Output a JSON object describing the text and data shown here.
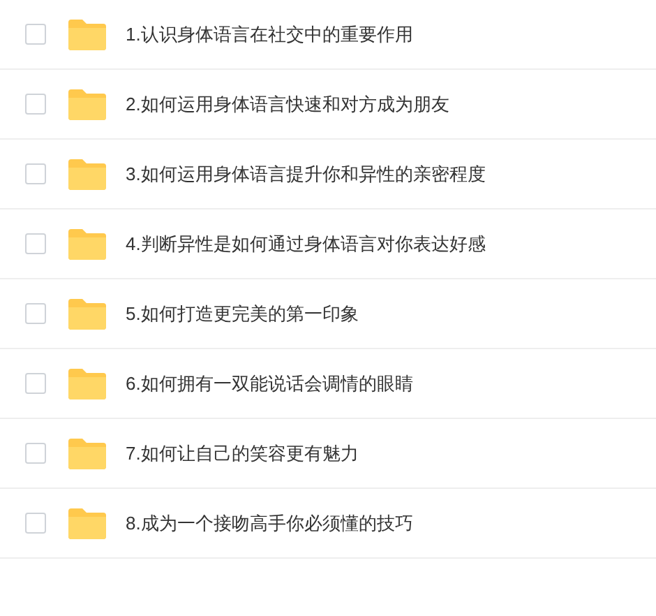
{
  "files": [
    {
      "name": "1.认识身体语言在社交中的重要作用",
      "checked": false
    },
    {
      "name": "2.如何运用身体语言快速和对方成为朋友",
      "checked": false
    },
    {
      "name": "3.如何运用身体语言提升你和异性的亲密程度",
      "checked": false
    },
    {
      "name": "4.判断异性是如何通过身体语言对你表达好感",
      "checked": false
    },
    {
      "name": "5.如何打造更完美的第一印象",
      "checked": false
    },
    {
      "name": "6.如何拥有一双能说话会调情的眼睛",
      "checked": false
    },
    {
      "name": "7.如何让自己的笑容更有魅力",
      "checked": false
    },
    {
      "name": "8.成为一个接吻高手你必须懂的技巧",
      "checked": false
    }
  ]
}
